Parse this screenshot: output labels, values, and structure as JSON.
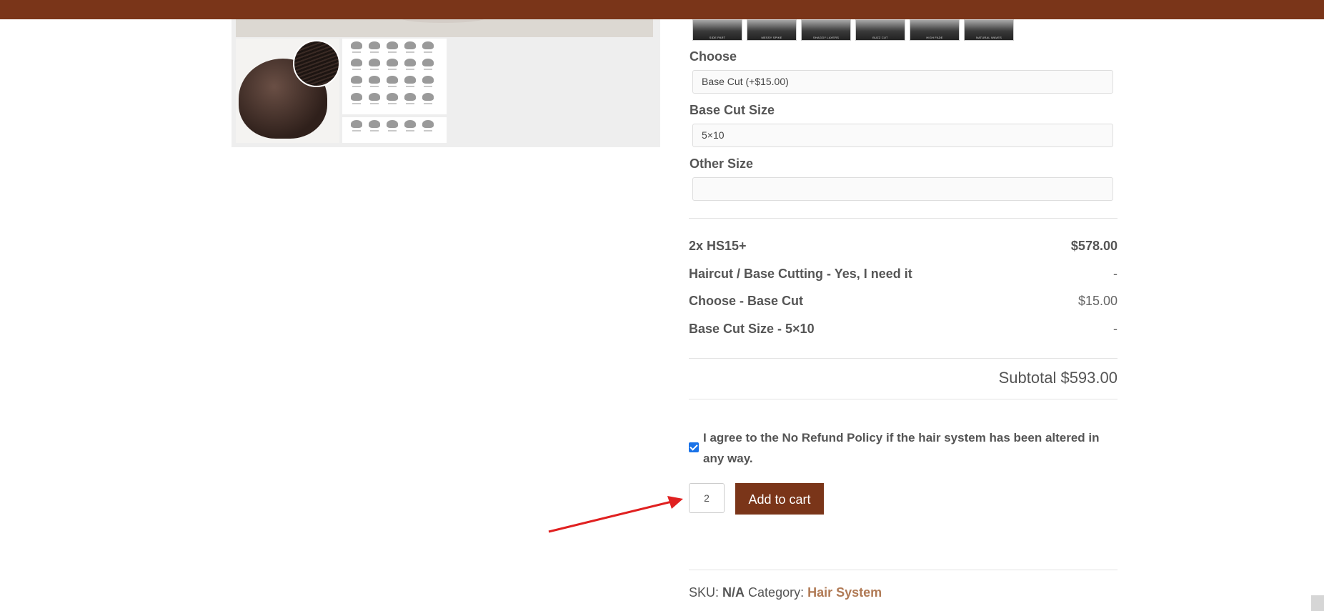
{
  "header": {
    "brand_color": "#7a3519"
  },
  "gallery": {
    "main_image_name": "hair-system-main-image",
    "thumbnails": [
      "hair-system-cap",
      "hair-color-swatches-1",
      "hair-color-swatches-2"
    ]
  },
  "style_thumbnails": [
    "SIDE PART",
    "MESSY SPIKE",
    "SHAGGY LAYERS",
    "BUZZ CUT",
    "HIGH FADE",
    "NATURAL WAVES"
  ],
  "form": {
    "choose_label": "Choose",
    "choose_value": "Base Cut (+$15.00)",
    "base_cut_size_label": "Base Cut Size",
    "base_cut_size_value": "5×10",
    "other_size_label": "Other Size",
    "other_size_value": ""
  },
  "summary": {
    "rows": [
      {
        "name": "2x HS15+",
        "price": "$578.00"
      },
      {
        "name": "Haircut / Base Cutting - Yes, I need it",
        "price": "-"
      },
      {
        "name": "Choose - Base Cut",
        "price": "$15.00"
      },
      {
        "name": "Base Cut Size - 5×10",
        "price": "-"
      }
    ],
    "subtotal": "Subtotal $593.00"
  },
  "agreement": {
    "checked": true,
    "text": "I agree to the No Refund Policy if the hair system has been altered in any way."
  },
  "cart": {
    "quantity": "2",
    "add_to_cart_label": "Add to cart",
    "button_color": "#7a3519"
  },
  "meta": {
    "sku_label": "SKU:",
    "sku_value": "N/A",
    "category_label": "Category:",
    "category_value": "Hair System"
  },
  "annotation": {
    "arrow_color": "#e02020"
  }
}
